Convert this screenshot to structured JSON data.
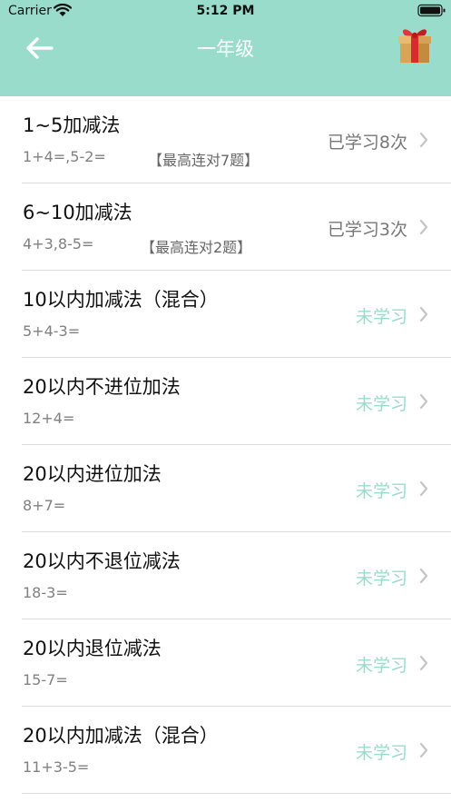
{
  "status_bar": {
    "carrier": "Carrier",
    "time": "5:12 PM"
  },
  "nav": {
    "title": "一年级",
    "back_icon": "arrow-left-icon",
    "gift_icon": "gift-box-icon"
  },
  "colors": {
    "header": "#9adccb",
    "unlearned": "#9adccb",
    "learned": "#777777"
  },
  "lessons": [
    {
      "title": "1~5加减法",
      "example": "1+4=,5-2=",
      "best": "【最高连对7题】",
      "status": "已学习8次",
      "learned": true
    },
    {
      "title": "6~10加减法",
      "example": "4+3,8-5=",
      "best": "【最高连对2题】",
      "status": "已学习3次",
      "learned": true
    },
    {
      "title": "10以内加减法（混合）",
      "example": "5+4-3=",
      "status": "未学习",
      "learned": false
    },
    {
      "title": "20以内不进位加法",
      "example": "12+4=",
      "status": "未学习",
      "learned": false
    },
    {
      "title": "20以内进位加法",
      "example": "8+7=",
      "status": "未学习",
      "learned": false
    },
    {
      "title": "20以内不退位减法",
      "example": "18-3=",
      "status": "未学习",
      "learned": false
    },
    {
      "title": "20以内退位减法",
      "example": "15-7=",
      "status": "未学习",
      "learned": false
    },
    {
      "title": "20以内加减法（混合）",
      "example": "11+3-5=",
      "status": "未学习",
      "learned": false
    }
  ]
}
